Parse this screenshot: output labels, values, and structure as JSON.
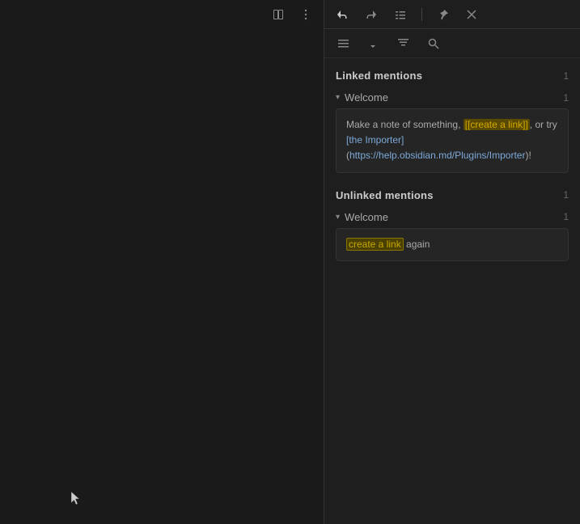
{
  "leftPanel": {
    "topIcons": [
      "book-icon",
      "more-icon"
    ]
  },
  "rightPanel": {
    "topToolbar": {
      "icons": [
        "backlinks-active-icon",
        "forward-links-icon",
        "outline-icon",
        "divider-icon",
        "pin-icon",
        "close-icon"
      ]
    },
    "secondaryToolbar": {
      "icons": [
        "list-icon",
        "sort-asc-icon",
        "sort-grouped-icon",
        "search-icon"
      ]
    },
    "linkedMentions": {
      "title": "Linked mentions",
      "count": "1",
      "subsections": [
        {
          "title": "Welcome",
          "count": "1",
          "content_before": "Make a note of something, ",
          "link_text": "[[create a link]]",
          "content_after": ", or try [the Importer] (https://help.obsidian.md/Plugins/Importer)!"
        }
      ]
    },
    "unlinkedMentions": {
      "title": "Unlinked mentions",
      "count": "1",
      "subsections": [
        {
          "title": "Welcome",
          "count": "1",
          "highlight_text": "create a link",
          "content_after": " again"
        }
      ]
    }
  }
}
